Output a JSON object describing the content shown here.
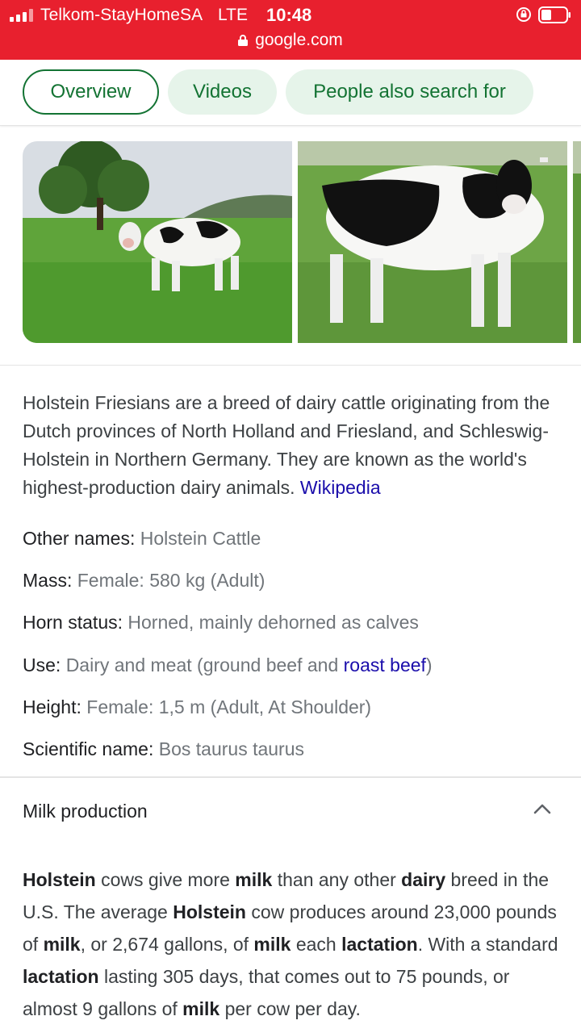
{
  "status": {
    "carrier": "Telkom-StayHomeSA",
    "network": "LTE",
    "time": "10:48"
  },
  "url": "google.com",
  "chips": [
    {
      "label": "Overview",
      "active": true
    },
    {
      "label": "Videos",
      "active": false
    },
    {
      "label": "People also search for",
      "active": false
    }
  ],
  "description": {
    "text": "Holstein Friesians are a breed of dairy cattle originating from the Dutch provinces of North Holland and Friesland, and Schleswig-Holstein in Northern Germany. They are known as the world's highest-production dairy animals.",
    "source": "Wikipedia"
  },
  "facts": {
    "other_names": {
      "key": "Other names:",
      "value": "Holstein Cattle"
    },
    "mass": {
      "key": "Mass:",
      "value": "Female: 580 kg (Adult)"
    },
    "horn_status": {
      "key": "Horn status:",
      "value": "Horned, mainly dehorned as calves"
    },
    "use": {
      "key": "Use:",
      "value_prefix": "Dairy and meat (ground beef and",
      "link": "roast beef",
      "value_suffix": ")"
    },
    "height": {
      "key": "Height:",
      "value": "Female: 1,5 m (Adult, At Shoulder)"
    },
    "scientific_name": {
      "key": "Scientific name:",
      "value": "Bos taurus taurus"
    }
  },
  "accordion": {
    "title": "Milk production",
    "expanded": true
  },
  "milk_text": {
    "s1": "Holstein",
    "s2": " cows give more ",
    "s3": "milk",
    "s4": " than any other ",
    "s5": "dairy",
    "s6": " breed in the U.S. The average ",
    "s7": "Holstein",
    "s8": " cow produces around 23,000 pounds of ",
    "s9": "milk",
    "s10": ", or 2,674 gallons, of ",
    "s11": "milk",
    "s12": " each ",
    "s13": "lactation",
    "s14": ". With a standard ",
    "s15": "lactation",
    "s16": " lasting 305 days, that comes out to 75 pounds, or almost 9 gallons of ",
    "s17": "milk",
    "s18": " per cow per day."
  },
  "colors": {
    "topbar": "#e8202e",
    "chip_bg": "#e6f4ea",
    "chip_text": "#137333",
    "link": "#1a0dab"
  }
}
